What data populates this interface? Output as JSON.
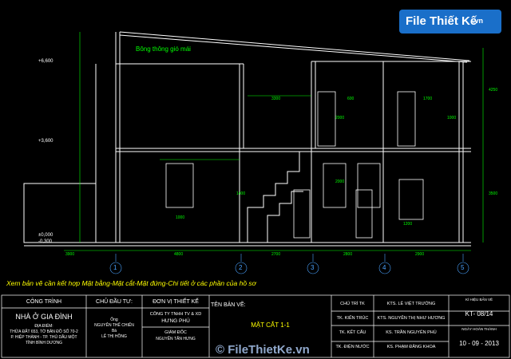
{
  "watermark": {
    "brand": "File Thiết Kế",
    "domain": ".vn"
  },
  "footer_watermark": "© FileThietKe.vn",
  "note": "Xem bản vẽ cần kết hợp Mặt bằng-Mặt cắt-Mặt đứng-Chi tiết ở các phần của hồ sơ",
  "vent_label": "Bông thông gió mái",
  "levels": [
    "+6,600",
    "+3,600",
    "±0,000",
    "-0,300"
  ],
  "axes": [
    "1",
    "2",
    "3",
    "4",
    "5"
  ],
  "dims_bottom": [
    "3900",
    "4800",
    "2700",
    "2800",
    "2900"
  ],
  "dims_upper": [
    "3300",
    "600",
    "1700",
    "2000",
    "1000",
    "1700",
    "1600"
  ],
  "dims_lower": [
    "1000",
    "1400",
    "2000",
    "1200",
    "1000",
    "3300",
    "300"
  ],
  "dims_right": [
    "4250",
    "3500",
    "1400"
  ],
  "title_block": {
    "cong_trinh_h": "CÔNG TRÌNH",
    "cong_trinh": "NHÀ Ở GIA ĐÌNH",
    "dia_diem_h": "ĐỊA ĐIỂM:",
    "dia_diem": [
      "THỬA ĐẤT 653, TỜ BẢN ĐỒ SỐ 70-2",
      "P. HIỆP THÀNH - TP. THỦ DẦU MỘT",
      "TỈNH BÌNH DƯƠNG"
    ],
    "chu_dau_tu_h": "CHỦ ĐẦU TƯ:",
    "chu_dau_tu": [
      "Ông",
      "NGUYỄN THẾ CHIẾN",
      "Bà",
      "LÊ THỊ HỒNG"
    ],
    "don_vi_h": "ĐƠN VỊ THIẾT KẾ",
    "don_vi": [
      "CÔNG TY TNHH TV & XD",
      "HƯNG PHÚ"
    ],
    "giam_doc_h": "GIÁM ĐỐC",
    "giam_doc": "NGUYỄN TẤN HƯNG",
    "ten_ban_ve_h": "TÊN BẢN VẼ:",
    "ten_ban_ve": "MẶT CẮT 1-1",
    "roles": [
      {
        "role": "CHỦ TRÌ TK",
        "name": "KTS. LÊ VIỆT TRƯỜNG"
      },
      {
        "role": "TK. KIẾN TRÚC",
        "name": "KTS. NGUYỄN THỊ NHƯ HƯƠNG"
      },
      {
        "role": "TK. KẾT CẤU",
        "name": "KS. TRẦN NGUYÊN PHÚ"
      },
      {
        "role": "TK. ĐIỆN NƯỚC",
        "name": "KS. PHẠM ĐĂNG KHOA"
      }
    ],
    "ky_hieu_h": "KÍ HIỆU BẢN VẼ",
    "ky_hieu": "KT- 08/14",
    "ngay_h": "NGÀY HOÀN THÀNH",
    "ngay": "10 - 09 - 2013"
  },
  "colors": {
    "bg": "#000000",
    "line": "#ffffff",
    "dim": "#00ff00",
    "axis": "#4aa3ff",
    "note": "#ffff00",
    "title_red": "#ff3333"
  }
}
